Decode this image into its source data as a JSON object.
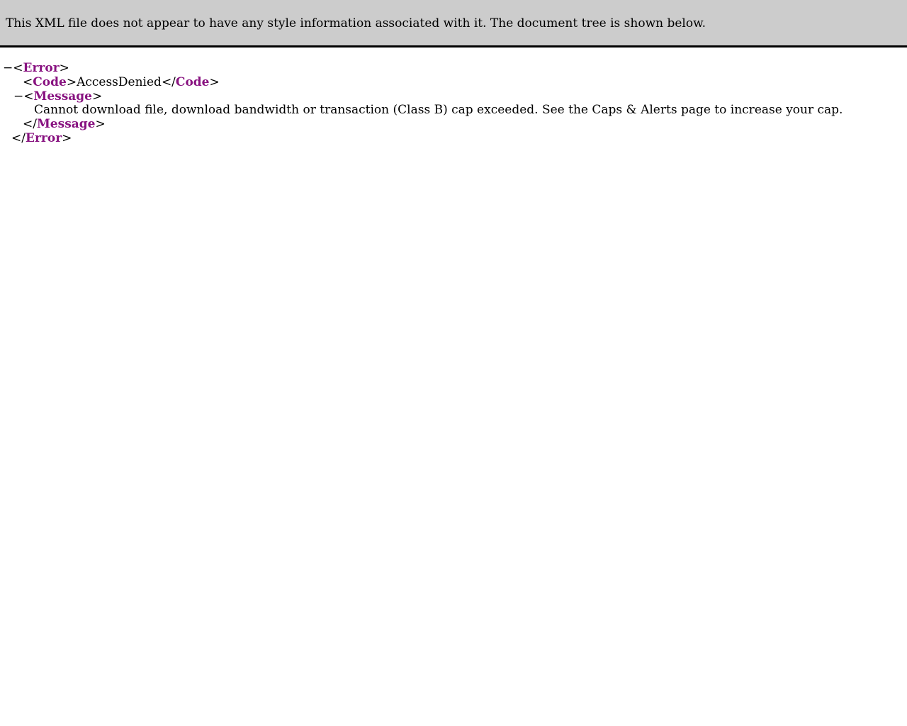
{
  "banner": {
    "text": "This XML file does not appear to have any style information associated with it. The document tree is shown below."
  },
  "tree": {
    "collapse_glyph": "−",
    "open_bracket": "<",
    "close_bracket": ">",
    "end_open_bracket": "</",
    "root_tag": "Error",
    "code_tag": "Code",
    "code_value": "AccessDenied",
    "message_tag": "Message",
    "message_value": "Cannot download file, download bandwidth or transaction (Class B) cap exceeded. See the Caps & Alerts page to increase your cap."
  },
  "colors": {
    "tag_name": "#881280",
    "banner_bg": "#cccccc"
  }
}
